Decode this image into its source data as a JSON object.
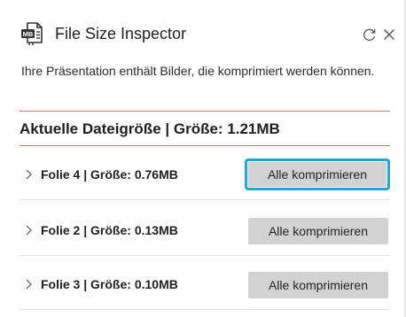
{
  "header": {
    "title": "File Size Inspector",
    "app_icon": "mb-file-icon",
    "refresh_icon": "refresh-icon",
    "close_icon": "close-icon"
  },
  "description": "Ihre Präsentation enthält Bilder, die komprimiert werden können.",
  "current_size": {
    "label": "Aktuelle Dateigröße | Größe: 1.21MB"
  },
  "slides": [
    {
      "label": "Folie 4 | Größe: 0.76MB",
      "button_label": "Alle komprimieren",
      "focused": true
    },
    {
      "label": "Folie 2 | Größe: 0.13MB",
      "button_label": "Alle komprimieren",
      "focused": false
    },
    {
      "label": "Folie 3 | Größe: 0.10MB",
      "button_label": "Alle komprimieren",
      "focused": false
    }
  ],
  "colors": {
    "accent_divider": "#c9826f",
    "focus_ring": "#1ea7d8",
    "button_bg": "#d2d2d2"
  }
}
